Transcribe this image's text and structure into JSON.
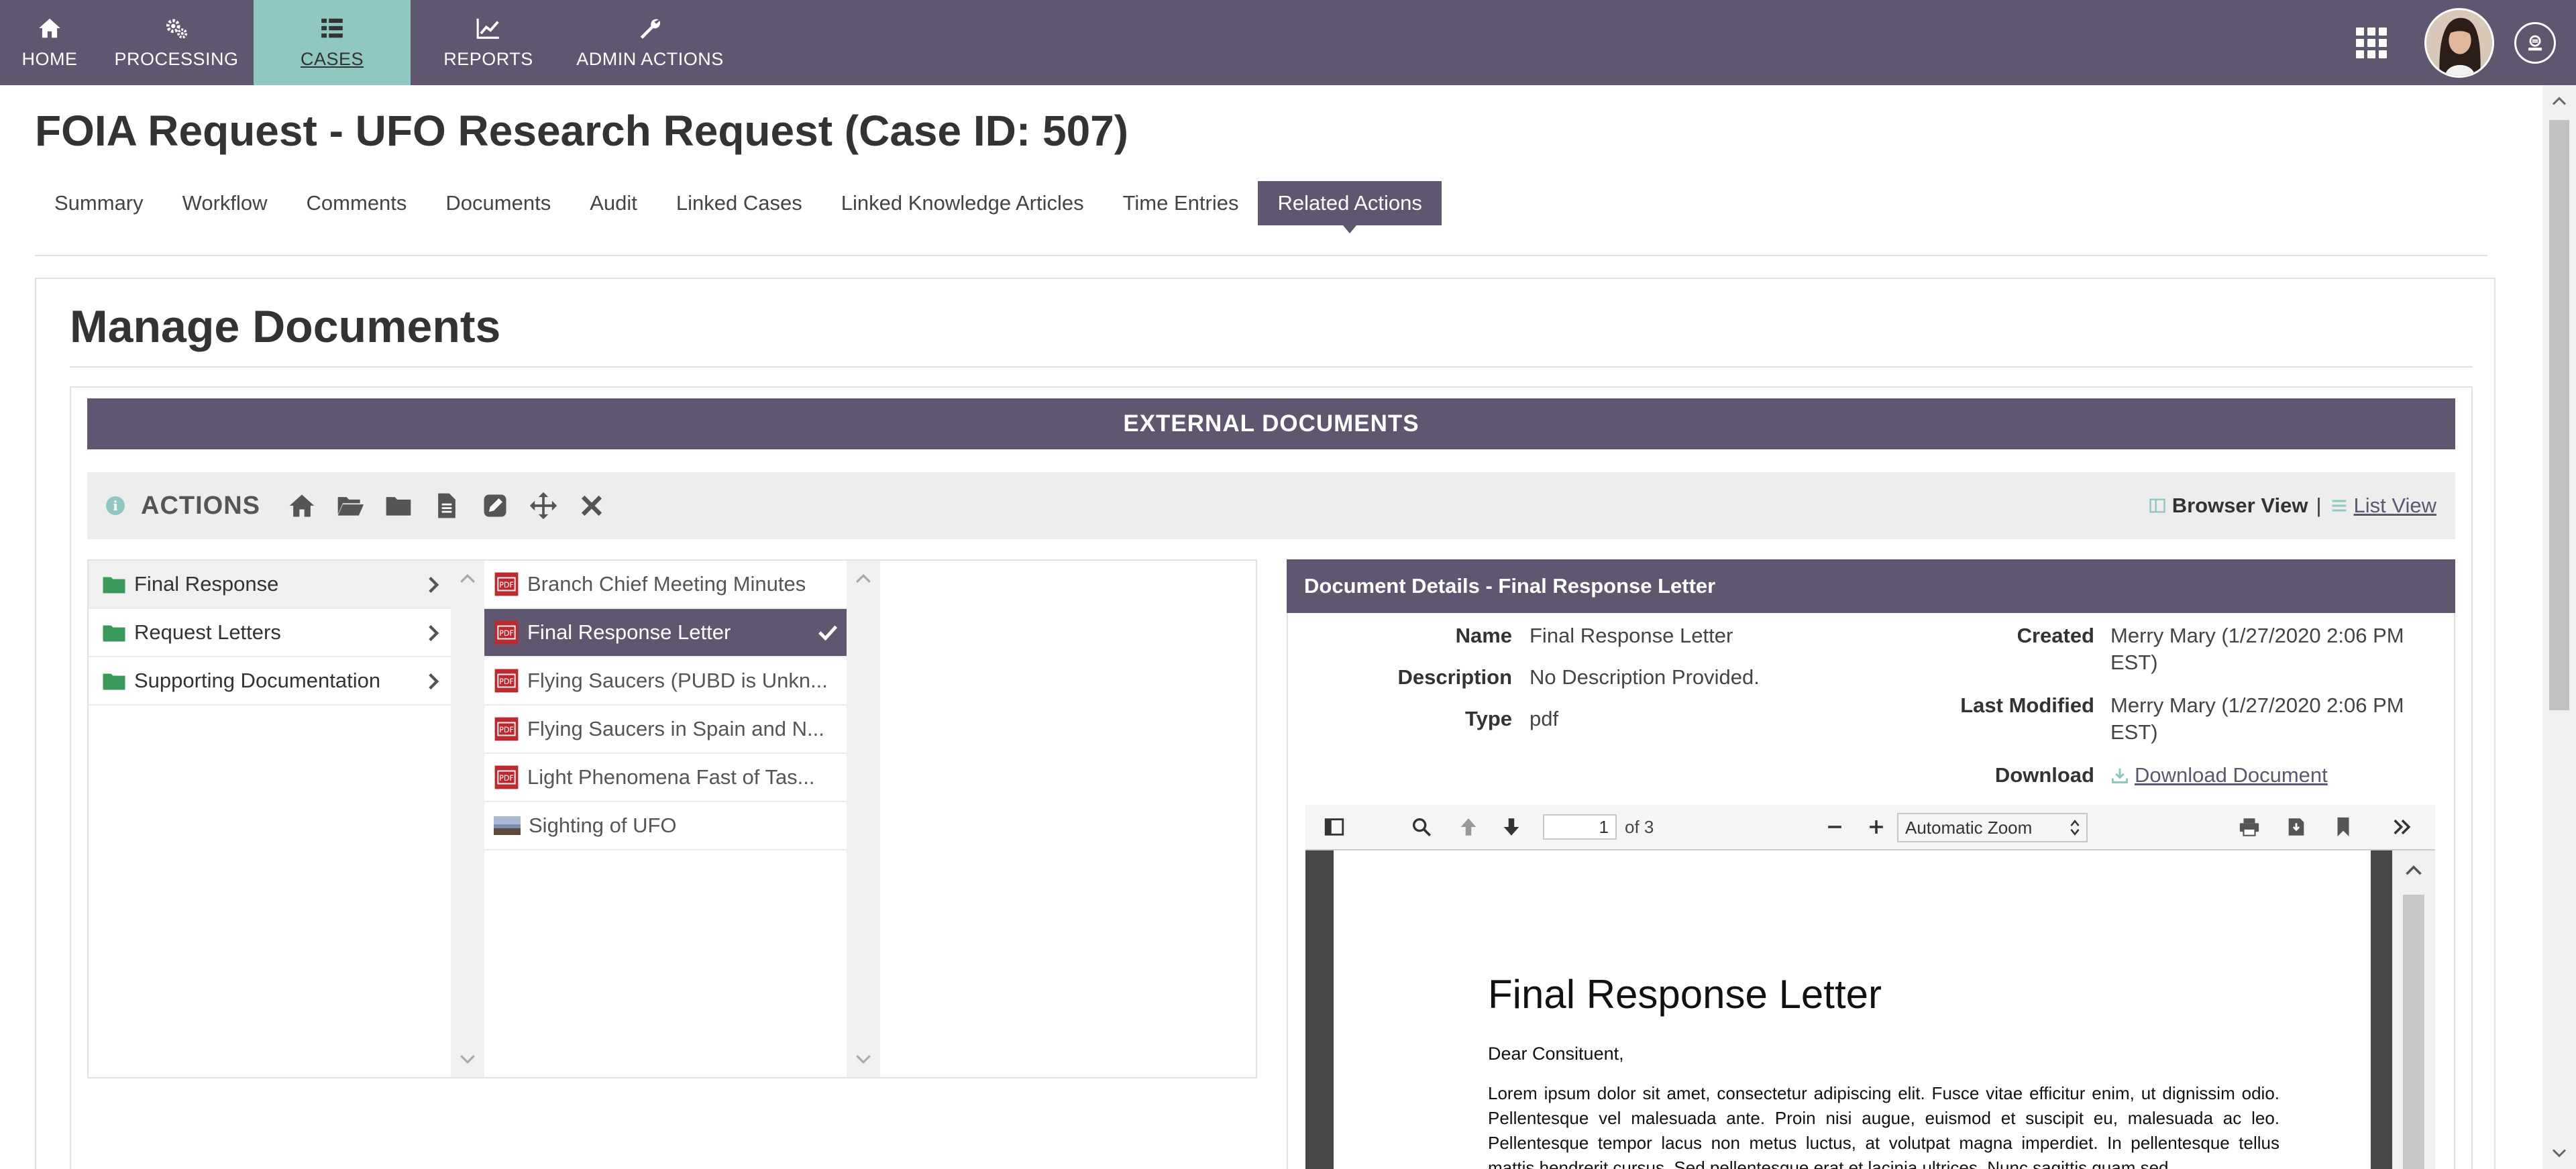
{
  "nav": {
    "items": [
      {
        "label": "HOME",
        "icon": "home-icon"
      },
      {
        "label": "PROCESSING",
        "icon": "gears-icon"
      },
      {
        "label": "CASES",
        "icon": "list-icon",
        "active": true
      },
      {
        "label": "REPORTS",
        "icon": "line-chart-icon"
      },
      {
        "label": "ADMIN ACTIONS",
        "icon": "wrench-icon"
      }
    ],
    "right": {
      "apps_icon": "apps-grid-icon",
      "avatar": "user-avatar",
      "logo": "brand-logo-icon"
    }
  },
  "colors": {
    "primary": "#5f566f",
    "accent": "#8fc7c2",
    "pdf_red": "#c0282e",
    "folder_green": "#3a9a5b"
  },
  "page": {
    "title": "FOIA Request - UFO Research Request (Case ID: 507)"
  },
  "tabs": [
    {
      "label": "Summary"
    },
    {
      "label": "Workflow"
    },
    {
      "label": "Comments"
    },
    {
      "label": "Documents"
    },
    {
      "label": "Audit"
    },
    {
      "label": "Linked Cases"
    },
    {
      "label": "Linked Knowledge Articles"
    },
    {
      "label": "Time Entries"
    },
    {
      "label": "Related Actions",
      "active": true
    }
  ],
  "section": {
    "title": "Manage Documents",
    "external_header": "EXTERNAL DOCUMENTS"
  },
  "actions": {
    "label": "ACTIONS",
    "buttons": [
      "home-icon",
      "open-folder-icon",
      "folder-icon",
      "document-icon",
      "edit-icon",
      "move-icon",
      "delete-icon"
    ],
    "view_browser": "Browser View",
    "view_separator": "|",
    "view_list": "List View"
  },
  "folders": [
    {
      "label": "Final Response",
      "active": true
    },
    {
      "label": "Request Letters"
    },
    {
      "label": "Supporting Documentation"
    }
  ],
  "files": [
    {
      "label": "Branch Chief Meeting Minutes",
      "type": "pdf"
    },
    {
      "label": "Final Response Letter",
      "type": "pdf",
      "selected": true
    },
    {
      "label": "Flying Saucers (PUBD is Unkn...",
      "type": "pdf"
    },
    {
      "label": "Flying Saucers in Spain and N...",
      "type": "pdf"
    },
    {
      "label": "Light Phenomena Fast of Tas...",
      "type": "pdf"
    },
    {
      "label": "Sighting of UFO",
      "type": "image"
    }
  ],
  "details": {
    "header": "Document Details - Final Response Letter",
    "name_label": "Name",
    "name_value": "Final Response Letter",
    "description_label": "Description",
    "description_value": "No Description Provided.",
    "type_label": "Type",
    "type_value": "pdf",
    "created_label": "Created",
    "created_value_1": "Merry Mary (1/27/2020 2:06 PM",
    "created_value_2": "EST)",
    "modified_label": "Last Modified",
    "modified_value_1": "Merry Mary (1/27/2020 2:06 PM",
    "modified_value_2": "EST)",
    "download_label": "Download",
    "download_link": "Download Document"
  },
  "pdf": {
    "page_current": "1",
    "page_total_text": "of 3",
    "zoom": "Automatic Zoom",
    "doc_title": "Final Response Letter",
    "greeting": "Dear Consituent,",
    "body": "Lorem ipsum dolor sit amet, consectetur adipiscing elit. Fusce vitae efficitur enim, ut dignissim odio. Pellentesque vel malesuada ante. Proin nisi augue, euismod et suscipit eu, malesuada ac leo. Pellentesque tempor lacus non metus luctus, at volutpat magna imperdiet. In pellentesque tellus mattis hendrerit cursus. Sed pellentesque erat et lacinia ultrices. Nunc sagittis quam sed"
  }
}
